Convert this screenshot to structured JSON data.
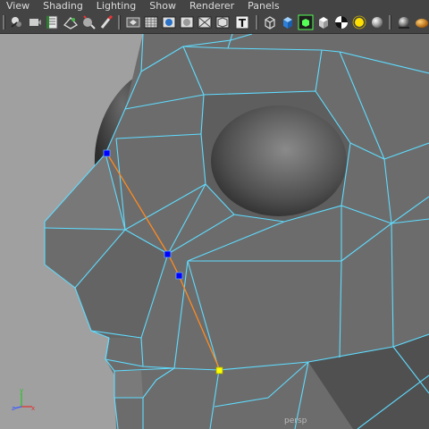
{
  "menubar": {
    "items": [
      {
        "label": "View"
      },
      {
        "label": "Shading"
      },
      {
        "label": "Lighting"
      },
      {
        "label": "Show"
      },
      {
        "label": "Renderer"
      },
      {
        "label": "Panels"
      }
    ]
  },
  "toolbar": {
    "icons": [
      "select-camera-icon",
      "camera-attributes-icon",
      "bookmarks-icon",
      "image-plane-icon",
      "grid-icon",
      "film-gate-icon",
      "resolution-gate-icon",
      "gate-mask-icon",
      "wireframe-icon",
      "smooth-shade-icon",
      "wireframe-on-shaded-icon",
      "textured-icon",
      "use-all-lights-icon",
      "shadows-icon",
      "xray-icon",
      "isolate-select-icon",
      "cube-wireframe-icon",
      "cube-shaded-icon",
      "frame-selection-icon",
      "cube-lit-icon",
      "checker-icon",
      "default-light-icon",
      "sphere-lit-icon",
      "sphere-shaded-icon",
      "render-icon"
    ]
  },
  "viewport": {
    "camera_label": "persp",
    "axis": {
      "x": "x",
      "y": "y",
      "z": "z"
    },
    "colors": {
      "background": "#a0a0a0",
      "wire": "#5fdcff",
      "edge_selected": "#ff8a1f",
      "vertex_selected": "#0000ff",
      "vertex_active": "#ffff00"
    }
  }
}
